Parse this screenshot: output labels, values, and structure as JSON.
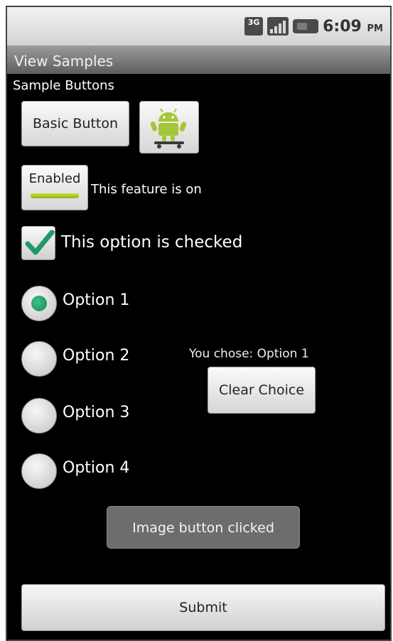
{
  "status_bar": {
    "network": "3G",
    "time": "6:09",
    "ampm": "PM"
  },
  "title_bar": {
    "title": "View Samples"
  },
  "section_label": "Sample Buttons",
  "basic_button": {
    "label": "Basic Button"
  },
  "image_button": {
    "icon": "android-skateboard-icon"
  },
  "toggle_button": {
    "label": "Enabled",
    "on": true,
    "status_text": "This feature is on"
  },
  "checkbox": {
    "label": "This option is checked",
    "checked": true
  },
  "radio_group": {
    "options": [
      "Option 1",
      "Option 2",
      "Option 3",
      "Option 4"
    ],
    "selected_index": 0
  },
  "chosen_text": "You chose: Option 1",
  "clear_button": {
    "label": "Clear Choice"
  },
  "toast": {
    "message": "Image button clicked"
  },
  "submit_button": {
    "label": "Submit"
  },
  "colors": {
    "accent_green": "#16875a",
    "toggle_led": "#a5c82a",
    "background": "#000000"
  }
}
